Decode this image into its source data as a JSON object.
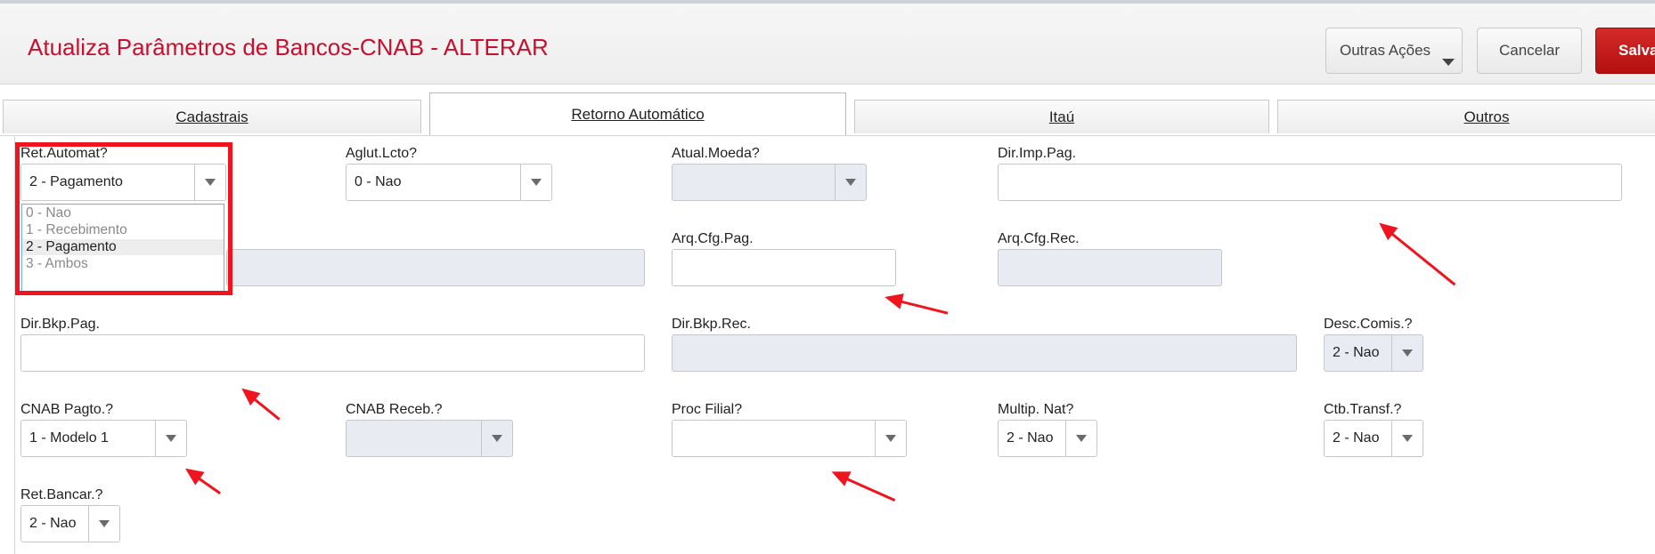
{
  "header": {
    "title": "Atualiza Parâmetros de Bancos-CNAB - ALTERAR",
    "more_actions": "Outras Ações",
    "cancel": "Cancelar",
    "save": "Salvar"
  },
  "tabs": [
    {
      "label": "Cadastrais",
      "active": false
    },
    {
      "label": "Retorno Automático",
      "active": true
    },
    {
      "label": "Itaú",
      "active": false
    },
    {
      "label": "Outros",
      "active": false
    }
  ],
  "fields": {
    "ret_automat": {
      "label": "Ret.Automat?",
      "value": "2 - Pagamento"
    },
    "aglut_lcto": {
      "label": "Aglut.Lcto?",
      "value": "0 - Nao"
    },
    "atual_moeda": {
      "label": "Atual.Moeda?",
      "value": ""
    },
    "dir_imp_pag": {
      "label": "Dir.Imp.Pag.",
      "value": ""
    },
    "arq_cfg_pag": {
      "label": "Arq.Cfg.Pag.",
      "value": ""
    },
    "arq_cfg_rec": {
      "label": "Arq.Cfg.Rec.",
      "value": ""
    },
    "dir_bkp_pag": {
      "label": "Dir.Bkp.Pag.",
      "value": ""
    },
    "dir_bkp_rec": {
      "label": "Dir.Bkp.Rec.",
      "value": ""
    },
    "desc_comis": {
      "label": "Desc.Comis.?",
      "value": "2 - Nao"
    },
    "cnab_pagto": {
      "label": "CNAB Pagto.?",
      "value": "1 - Modelo 1"
    },
    "cnab_receb": {
      "label": "CNAB Receb.?",
      "value": ""
    },
    "proc_filial": {
      "label": "Proc Filial?",
      "value": ""
    },
    "multip_nat": {
      "label": "Multip. Nat?",
      "value": "2 - Nao"
    },
    "ctb_transf": {
      "label": "Ctb.Transf.?",
      "value": "2 - Nao"
    },
    "ret_bancar": {
      "label": "Ret.Bancar.?",
      "value": "2 - Nao"
    }
  },
  "dropdown_options": [
    "0 - Nao",
    "1 - Recebimento",
    "2 - Pagamento",
    "3 - Ambos"
  ],
  "colors": {
    "brand_red": "#c8102e",
    "annotation_red": "#f0141e",
    "disabled_bg": "#e8ebf1"
  }
}
